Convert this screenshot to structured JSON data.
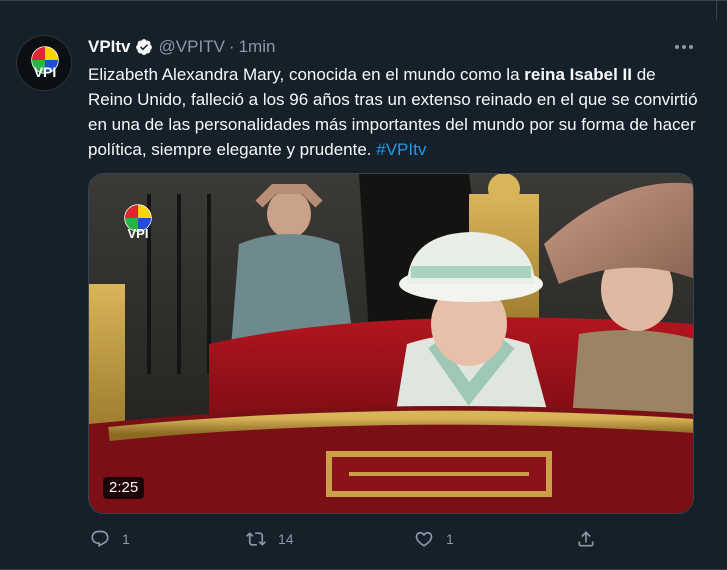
{
  "tweet": {
    "display_name": "VPItv",
    "handle": "@VPITV",
    "separator": "·",
    "time": "1min",
    "text_part1": "Elizabeth Alexandra Mary, conocida en el mundo como la ",
    "text_bold": "reina Isabel II",
    "text_part2": " de Reino Unido, falleció a los 96 años tras un extenso reinado en el que se convirtió en una de las personalidades más importantes del mundo por su forma de hacer política, siempre elegante y prudente. ",
    "hashtag": "#VPItv",
    "video_duration": "2:25",
    "avatar_logo_text": "VPI",
    "media_logo_text": "VPI"
  },
  "actions": {
    "reply_count": "1",
    "retweet_count": "14",
    "like_count": "1"
  },
  "colors": {
    "background": "#15202b",
    "accent": "#1d9bf0",
    "secondary_text": "#8b98a5",
    "verified": "#f7f9f9"
  },
  "icons": {
    "verified": "verified-badge-icon",
    "more": "more-dots-icon",
    "reply": "reply-icon",
    "retweet": "retweet-icon",
    "like": "heart-icon",
    "share": "share-icon"
  }
}
